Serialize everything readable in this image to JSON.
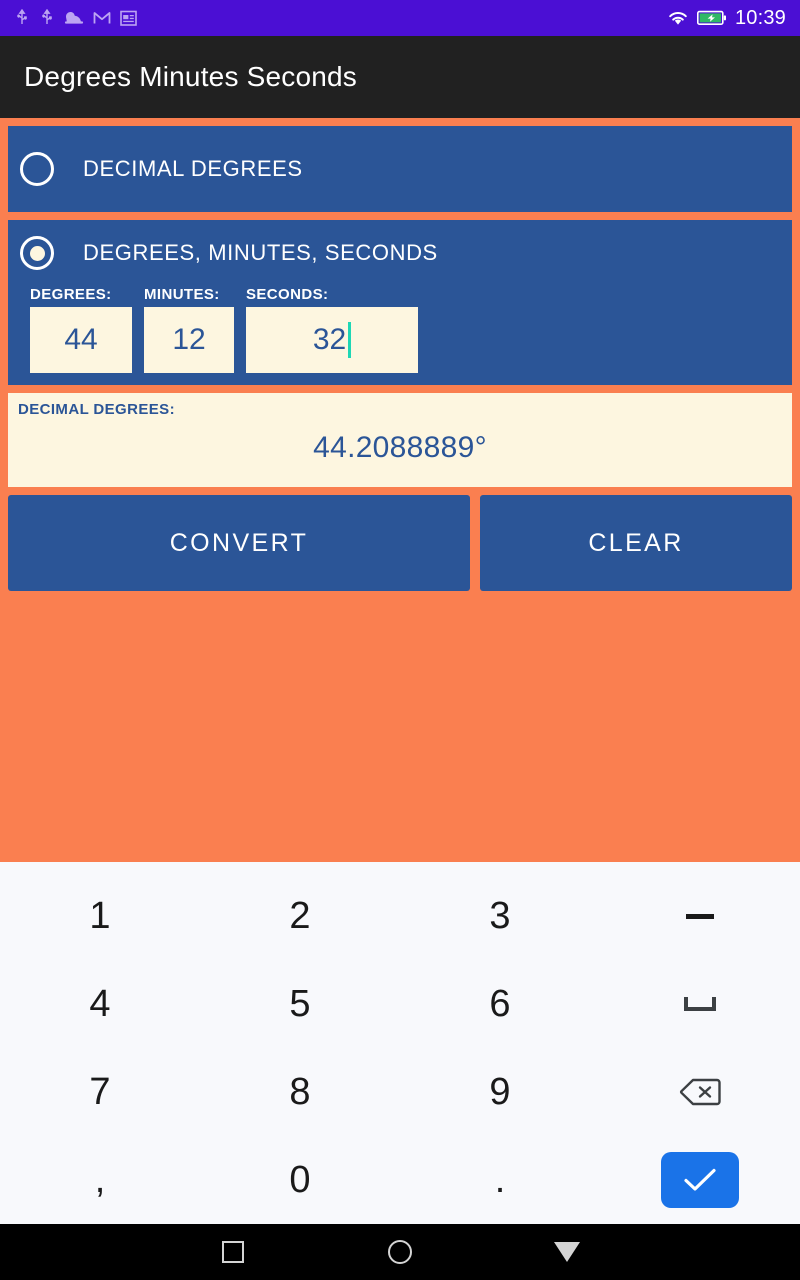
{
  "status_bar": {
    "icons": [
      "usb-icon",
      "usb-icon",
      "cloud-icon",
      "gmail-icon",
      "news-icon"
    ],
    "wifi_icon": "wifi-icon",
    "battery_icon": "battery-charging-icon",
    "time": "10:39",
    "background_color": "#4B0FD4"
  },
  "app_bar": {
    "title": "Degrees Minutes Seconds",
    "background_color": "#212121"
  },
  "theme": {
    "orange": "#FA7F50",
    "blue": "#2B5597",
    "cream": "#FDF6E0",
    "caret": "#1ED7B5",
    "enter_blue": "#1A73E8"
  },
  "mode_options": [
    {
      "id": "decimal-degrees",
      "label": "DECIMAL DEGREES",
      "selected": false
    },
    {
      "id": "degrees-minutes-seconds",
      "label": "DEGREES, MINUTES, SECONDS",
      "selected": true
    }
  ],
  "inputs": {
    "degrees": {
      "label": "DEGREES:",
      "value": "44"
    },
    "minutes": {
      "label": "MINUTES:",
      "value": "12"
    },
    "seconds": {
      "label": "SECONDS:",
      "value": "32",
      "focused": true
    }
  },
  "result": {
    "label": "DECIMAL DEGREES:",
    "value": "44.2088889°"
  },
  "buttons": {
    "convert": "CONVERT",
    "clear": "CLEAR"
  },
  "keyboard": {
    "rows": [
      [
        {
          "name": "key-1",
          "label": "1",
          "type": "text"
        },
        {
          "name": "key-2",
          "label": "2",
          "type": "text"
        },
        {
          "name": "key-3",
          "label": "3",
          "type": "text"
        },
        {
          "name": "key-minus",
          "label": "−",
          "type": "glyph-minus"
        }
      ],
      [
        {
          "name": "key-4",
          "label": "4",
          "type": "text"
        },
        {
          "name": "key-5",
          "label": "5",
          "type": "text"
        },
        {
          "name": "key-6",
          "label": "6",
          "type": "text"
        },
        {
          "name": "key-space",
          "label": "space",
          "type": "glyph-space"
        }
      ],
      [
        {
          "name": "key-7",
          "label": "7",
          "type": "text"
        },
        {
          "name": "key-8",
          "label": "8",
          "type": "text"
        },
        {
          "name": "key-9",
          "label": "9",
          "type": "text"
        },
        {
          "name": "key-backspace",
          "label": "backspace",
          "type": "glyph-backspace"
        }
      ],
      [
        {
          "name": "key-comma",
          "label": ",",
          "type": "text"
        },
        {
          "name": "key-0",
          "label": "0",
          "type": "text"
        },
        {
          "name": "key-period",
          "label": ".",
          "type": "text"
        },
        {
          "name": "key-enter",
          "label": "enter",
          "type": "glyph-enter"
        }
      ]
    ]
  },
  "nav_bar": {
    "recents": "recents-square",
    "home": "home-circle",
    "back": "back-triangle"
  }
}
